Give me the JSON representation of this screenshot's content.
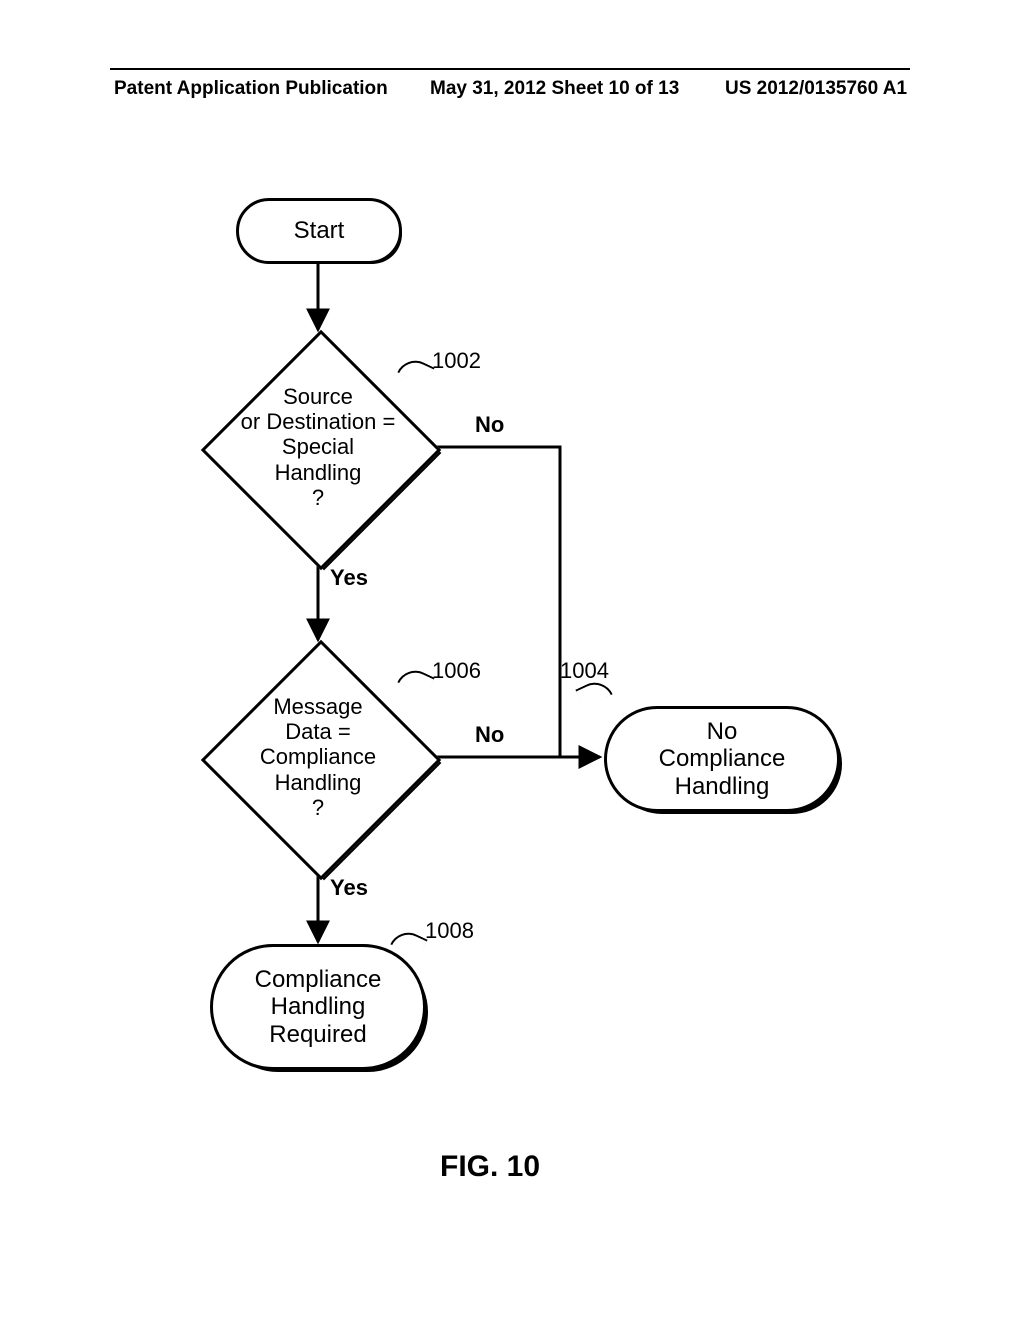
{
  "header": {
    "left": "Patent Application Publication",
    "mid": "May 31, 2012  Sheet 10 of 13",
    "right": "US 2012/0135760 A1"
  },
  "nodes": {
    "start": "Start",
    "d1": "Source\nor Destination =\nSpecial\nHandling\n?",
    "d2": "Message\nData =\nCompliance\nHandling\n?",
    "t_no": "No\nCompliance\nHandling",
    "t_yes": "Compliance\nHandling\nRequired"
  },
  "edges": {
    "no": "No",
    "yes": "Yes"
  },
  "refs": {
    "r1": "1002",
    "r2": "1004",
    "r3": "1006",
    "r4": "1008"
  },
  "caption": "FIG. 10"
}
